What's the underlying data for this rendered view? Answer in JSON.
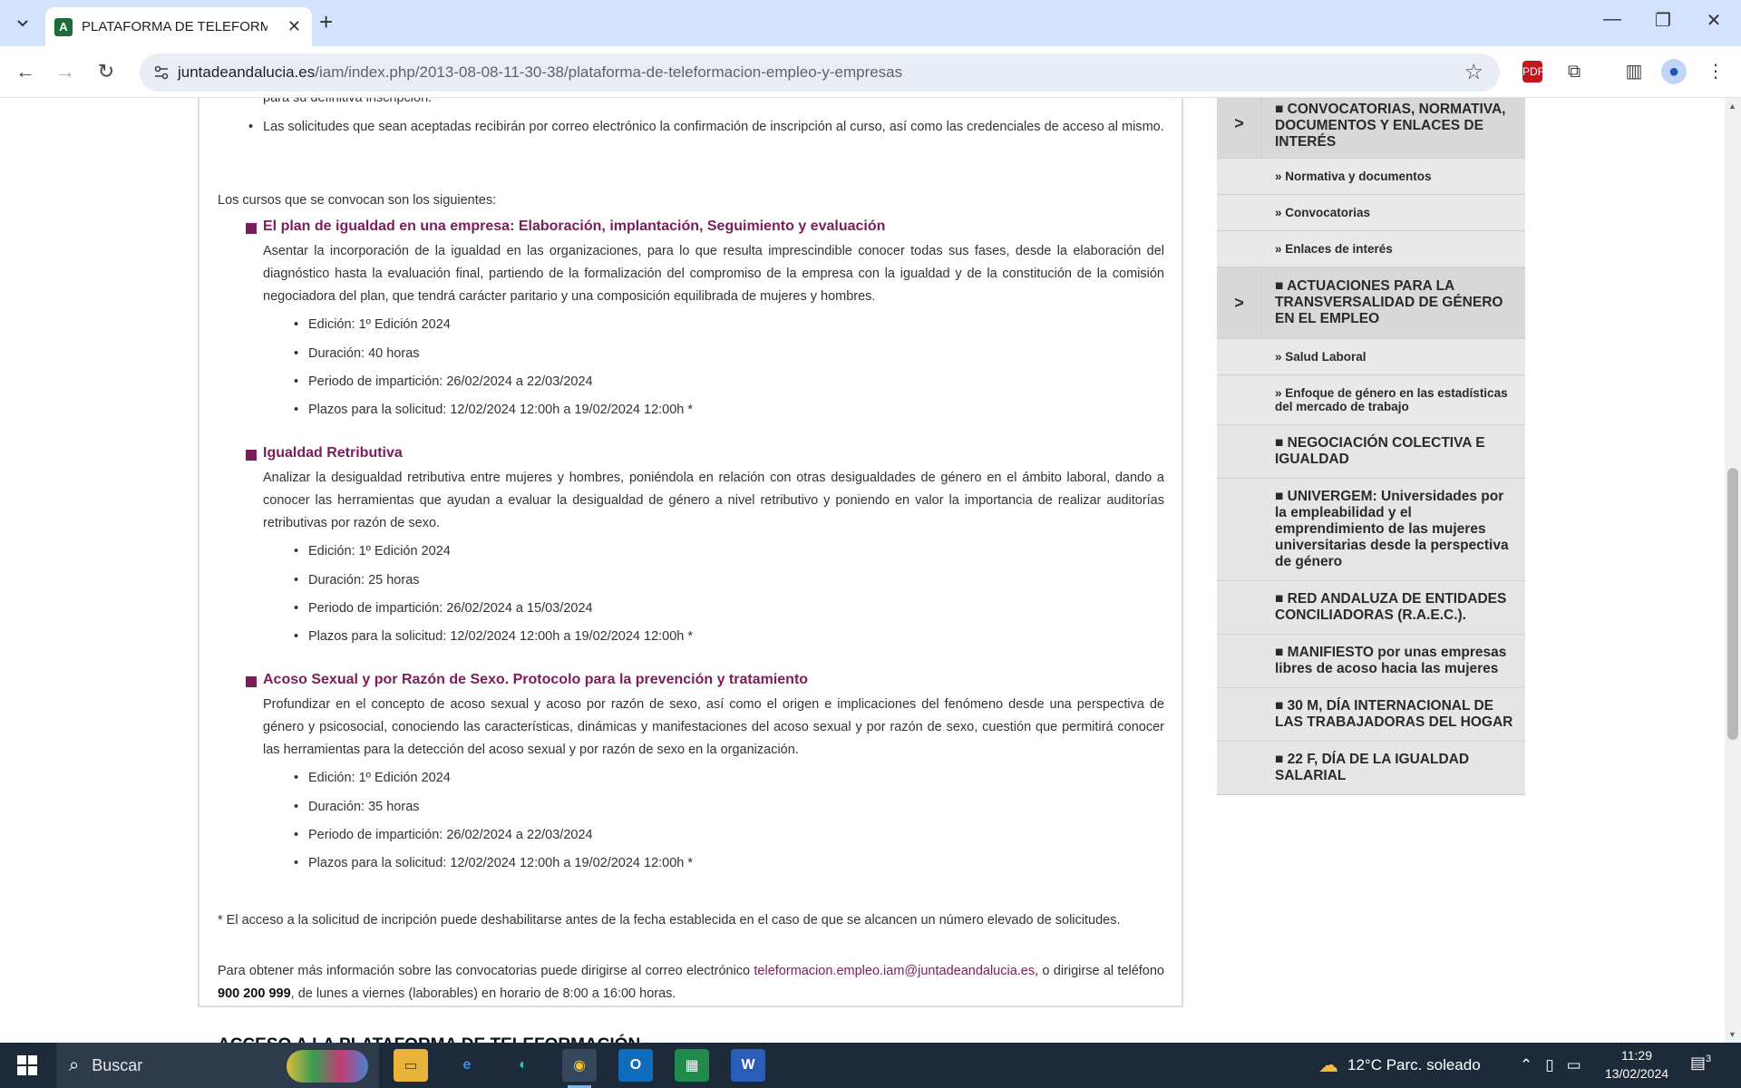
{
  "browser": {
    "tab_title": "PLATAFORMA DE TELEFORMACIÓN",
    "tab_favicon": "A",
    "url_domain": "juntadeandalucia.es",
    "url_path": "/iam/index.php/2013-08-08-11-30-38/plataforma-de-teleformacion-empleo-y-empresas"
  },
  "content": {
    "prev_line": "para su definitiva inscripción.",
    "accept_bullet": "Las solicitudes que sean aceptadas recibirán por correo electrónico la confirmación de inscripción al curso, así como las credenciales de acceso al mismo.",
    "intro": "Los cursos que se convocan son los siguientes:",
    "courses": [
      {
        "title": "El plan de igualdad en una empresa: Elaboración, implantación, Seguimiento y evaluación",
        "description": "Asentar la incorporación de la igualdad en las organizaciones, para lo que resulta imprescindible conocer todas sus fases, desde la elaboración del diagnóstico hasta la evaluación final, partiendo de la formalización del compromiso de la empresa con la igualdad y de la constitución de la comisión negociadora del plan, que tendrá carácter paritario y una composición equilibrada de mujeres y hombres.",
        "edition": "Edición: 1º Edición 2024",
        "duration": "Duración: 40 horas",
        "period": "Periodo de impartición: 26/02/2024 a 22/03/2024",
        "deadline": "Plazos para la solicitud: 12/02/2024 12:00h a 19/02/2024 12:00h *"
      },
      {
        "title": "Igualdad Retributiva",
        "description": "Analizar la desigualdad retributiva entre mujeres y hombres, poniéndola en relación con otras desigualdades de género en el ámbito laboral, dando a conocer las herramientas que ayudan a evaluar la desigualdad de género a nivel retributivo y poniendo en valor la importancia de realizar auditorías retributivas por razón de sexo.",
        "edition": "Edición: 1º Edición 2024",
        "duration": "Duración: 25 horas",
        "period": "Periodo de impartición: 26/02/2024 a 15/03/2024",
        "deadline": "Plazos para la solicitud: 12/02/2024 12:00h a 19/02/2024 12:00h *"
      },
      {
        "title": "Acoso Sexual y por Razón de Sexo. Protocolo para la prevención y tratamiento",
        "description": "Profundizar en el concepto de acoso sexual y acoso por razón de sexo, así como el origen e implicaciones del fenómeno desde una perspectiva de género y psicosocial, conociendo las características, dinámicas y manifestaciones del acoso sexual y por razón de sexo, cuestión que permitirá conocer las herramientas para la detección del acoso sexual y por razón de sexo en la organización.",
        "edition": "Edición: 1º Edición 2024",
        "duration": "Duración: 35 horas",
        "period": "Periodo de impartición: 26/02/2024 a 22/03/2024",
        "deadline": "Plazos para la solicitud: 12/02/2024 12:00h a 19/02/2024 12:00h *"
      }
    ],
    "footnote": "* El acceso a la solicitud de incripción puede deshabilitarse antes de la fecha establecida en el caso de que se alcancen un número elevado de solicitudes.",
    "info_pre": "Para obtener más información sobre las convocatorias puede dirigirse al correo electrónico ",
    "info_email": "teleformacion.empleo.iam@juntadeandalucia.es",
    "info_mid": ", o dirigirse al teléfono ",
    "info_phone": "900 200 999",
    "info_post": ", de lunes a viernes (laborables) en horario de 8:00 a 16:00 horas.",
    "next_heading": "ACCESO A LA PLATAFORMA DE TELEFORMACIÓN"
  },
  "sidebar": {
    "cat1": "■ CONVOCATORIAS, NORMATIVA, DOCUMENTOS Y ENLACES DE INTERÉS",
    "cat1_subs": [
      "» Normativa y documentos",
      "» Convocatorias",
      "» Enlaces de interés"
    ],
    "cat2": "■ ACTUACIONES PARA LA TRANSVERSALIDAD DE GÉNERO EN EL EMPLEO",
    "cat2_subs": [
      "» Salud Laboral",
      "» Enfoque de género en las estadísticas del mercado de trabajo"
    ],
    "items": [
      "■ NEGOCIACIÓN COLECTIVA E IGUALDAD",
      "■ UNIVERGEM: Universidades por la empleabilidad y el emprendimiento de las mujeres universitarias desde la perspectiva de género",
      "■ RED ANDALUZA DE ENTIDADES CONCILIADORAS (R.A.E.C.).",
      "■ MANIFIESTO por unas empresas libres de acoso hacia las mujeres",
      "■ 30 M, DÍA INTERNACIONAL DE LAS TRABAJADORAS DEL HOGAR",
      "■ 22 F, DÍA DE LA IGUALDAD SALARIAL"
    ]
  },
  "taskbar": {
    "search_placeholder": "Buscar",
    "weather": "12°C  Parc. soleado",
    "time": "11:29",
    "date": "13/02/2024",
    "notification_count": "3"
  },
  "colors": {
    "accent": "#7b1d5a",
    "chrome_bg": "#d3e3fd",
    "taskbar_bg": "#1c2a3a",
    "sidebar_bg": "#e6e6e6"
  }
}
